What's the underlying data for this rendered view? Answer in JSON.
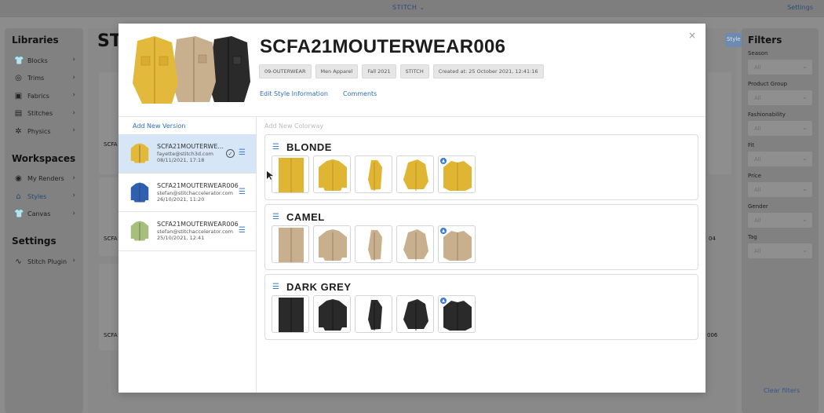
{
  "topbar": {
    "brand": "STITCH ⌄",
    "settings": "Settings"
  },
  "libraries": {
    "heading": "Libraries",
    "items": [
      {
        "label": "Blocks",
        "icon": "shirt-icon"
      },
      {
        "label": "Trims",
        "icon": "button-icon"
      },
      {
        "label": "Fabrics",
        "icon": "fabric-icon"
      },
      {
        "label": "Stitches",
        "icon": "stitches-icon"
      },
      {
        "label": "Physics",
        "icon": "physics-icon"
      }
    ]
  },
  "workspaces": {
    "heading": "Workspaces",
    "items": [
      {
        "label": "My Renders",
        "icon": "render-icon"
      },
      {
        "label": "Styles",
        "icon": "hanger-icon"
      },
      {
        "label": "Canvas",
        "icon": "shirt-icon"
      }
    ]
  },
  "settings": {
    "heading": "Settings",
    "items": [
      {
        "label": "Stitch Plugin",
        "icon": "plugin-icon"
      }
    ]
  },
  "background": {
    "page_title": "ST",
    "new_style_label": "Style",
    "labels": [
      "SCFA",
      "SCFA",
      "SCFA",
      "04",
      "006"
    ]
  },
  "filters": {
    "heading": "Filters",
    "groups": [
      {
        "label": "Season",
        "value": "All"
      },
      {
        "label": "Product Group",
        "value": "All"
      },
      {
        "label": "Fashionability",
        "value": "All"
      },
      {
        "label": "Fit",
        "value": "All"
      },
      {
        "label": "Price",
        "value": "All"
      },
      {
        "label": "Gender",
        "value": "All"
      },
      {
        "label": "Tag",
        "value": "All"
      }
    ],
    "clear": "Clear filters"
  },
  "modal": {
    "title": "SCFA21MOUTERWEAR006",
    "close": "×",
    "tags": [
      "09-OUTERWEAR",
      "Men Apparel",
      "Fall 2021",
      "STITCH",
      "Created at: 25 October 2021, 12:41:16"
    ],
    "links": {
      "edit": "Edit Style Information",
      "comments": "Comments"
    },
    "add_version": "Add New Version",
    "add_colorway": "Add New Colorway",
    "versions": [
      {
        "title": "SCFA21MOUTERWE...",
        "email": "fayette@stitch3d.com",
        "date": "08/11/2021, 17:18",
        "color": "#e3b93b"
      },
      {
        "title": "SCFA21MOUTERWEAR006",
        "email": "stefan@stitchaccelerator.com",
        "date": "26/10/2021, 11:20",
        "color": "#2f5fb0"
      },
      {
        "title": "SCFA21MOUTERWEAR006",
        "email": "stefan@stitchaccelerator.com",
        "date": "25/10/2021, 12:41",
        "color": "#a7bf7c"
      }
    ],
    "colorways": [
      {
        "name": "BLONDE",
        "color": "#e0b533",
        "dark": "#b58a1c"
      },
      {
        "name": "CAMEL",
        "color": "#c8b08e",
        "dark": "#8f7a5c"
      },
      {
        "name": "DARK GREY",
        "color": "#2a2a2a",
        "dark": "#111111"
      }
    ]
  }
}
